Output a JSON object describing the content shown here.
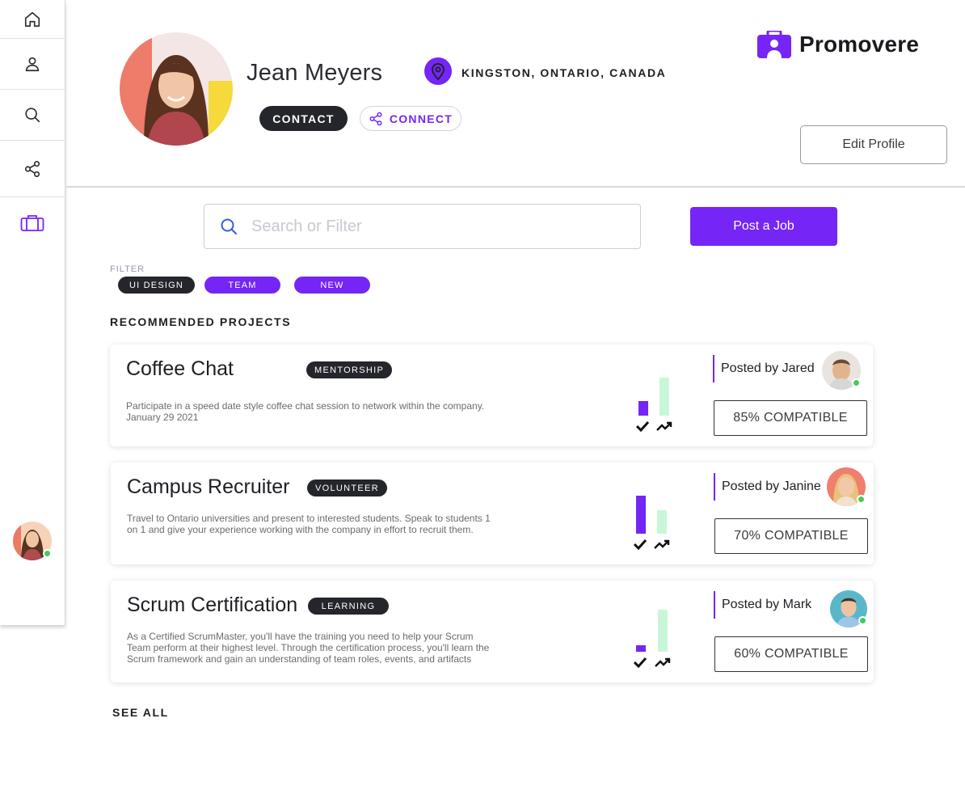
{
  "sidebar": {
    "items": [
      {
        "icon": "home-icon"
      },
      {
        "icon": "user-icon"
      },
      {
        "icon": "search-icon"
      },
      {
        "icon": "share-icon"
      },
      {
        "icon": "briefcase-icon",
        "active": true
      }
    ]
  },
  "profile": {
    "name": "Jean Meyers",
    "location": "KINGSTON, ONTARIO, CANADA",
    "contact_label": "CONTACT",
    "connect_label": "CONNECT",
    "edit_label": "Edit Profile"
  },
  "brand": {
    "name": "Promovere",
    "color": "#7525f5"
  },
  "search": {
    "placeholder": "Search or Filter"
  },
  "post_job_label": "Post a Job",
  "filter": {
    "label": "FILTER",
    "chips": [
      "UI DESIGN",
      "TEAM",
      "NEW"
    ]
  },
  "recommended_title": "RECOMMENDED PROJECTS",
  "projects": [
    {
      "title": "Coffee Chat",
      "tag": "MENTORSHIP",
      "description": "Participate in a speed date style coffee chat session to network within the company.",
      "date": "January 29 2021",
      "posted_by": "Posted by Jared",
      "compatible": "85% COMPATIBLE",
      "skill_match": 0.35,
      "growth": 0.9
    },
    {
      "title": "Campus Recruiter",
      "tag": "VOLUNTEER",
      "description": "Travel to Ontario universities and present to interested students. Speak to students 1 on 1 and give your experience working with the company in effort to recruit them.",
      "date": "",
      "posted_by": "Posted by Janine",
      "compatible": "70% COMPATIBLE",
      "skill_match": 0.9,
      "growth": 0.55
    },
    {
      "title": "Scrum Certification",
      "tag": "LEARNING",
      "description": "As a Certified ScrumMaster, you'll have the training you need to help your Scrum Team perform at their highest level. Through the certification process, you'll learn the Scrum framework and gain an understanding of team roles, events, and artifacts",
      "date": "",
      "posted_by": "Posted by Mark",
      "compatible": "60% COMPATIBLE",
      "skill_match": 0.15,
      "growth": 1.0
    }
  ],
  "see_all_label": "SEE ALL",
  "colors": {
    "accent": "#7525f5",
    "dark": "#25262b",
    "growth_bar": "#c8f7d8",
    "online": "#48c95f"
  }
}
